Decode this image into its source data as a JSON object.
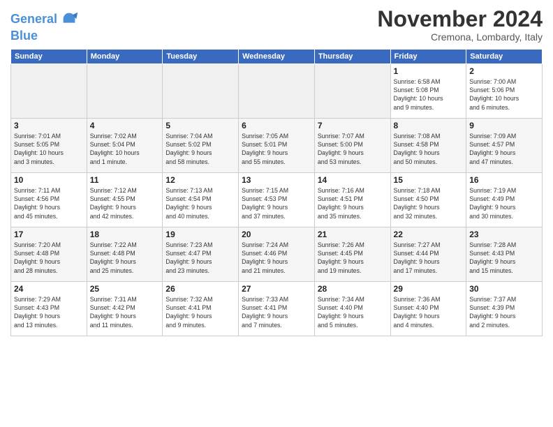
{
  "header": {
    "logo_line1": "General",
    "logo_line2": "Blue",
    "month": "November 2024",
    "location": "Cremona, Lombardy, Italy"
  },
  "weekdays": [
    "Sunday",
    "Monday",
    "Tuesday",
    "Wednesday",
    "Thursday",
    "Friday",
    "Saturday"
  ],
  "weeks": [
    {
      "days": [
        {
          "num": "",
          "info": "",
          "empty": true
        },
        {
          "num": "",
          "info": "",
          "empty": true
        },
        {
          "num": "",
          "info": "",
          "empty": true
        },
        {
          "num": "",
          "info": "",
          "empty": true
        },
        {
          "num": "",
          "info": "",
          "empty": true
        },
        {
          "num": "1",
          "info": "Sunrise: 6:58 AM\nSunset: 5:08 PM\nDaylight: 10 hours\nand 9 minutes."
        },
        {
          "num": "2",
          "info": "Sunrise: 7:00 AM\nSunset: 5:06 PM\nDaylight: 10 hours\nand 6 minutes."
        }
      ]
    },
    {
      "days": [
        {
          "num": "3",
          "info": "Sunrise: 7:01 AM\nSunset: 5:05 PM\nDaylight: 10 hours\nand 3 minutes."
        },
        {
          "num": "4",
          "info": "Sunrise: 7:02 AM\nSunset: 5:04 PM\nDaylight: 10 hours\nand 1 minute."
        },
        {
          "num": "5",
          "info": "Sunrise: 7:04 AM\nSunset: 5:02 PM\nDaylight: 9 hours\nand 58 minutes."
        },
        {
          "num": "6",
          "info": "Sunrise: 7:05 AM\nSunset: 5:01 PM\nDaylight: 9 hours\nand 55 minutes."
        },
        {
          "num": "7",
          "info": "Sunrise: 7:07 AM\nSunset: 5:00 PM\nDaylight: 9 hours\nand 53 minutes."
        },
        {
          "num": "8",
          "info": "Sunrise: 7:08 AM\nSunset: 4:58 PM\nDaylight: 9 hours\nand 50 minutes."
        },
        {
          "num": "9",
          "info": "Sunrise: 7:09 AM\nSunset: 4:57 PM\nDaylight: 9 hours\nand 47 minutes."
        }
      ]
    },
    {
      "days": [
        {
          "num": "10",
          "info": "Sunrise: 7:11 AM\nSunset: 4:56 PM\nDaylight: 9 hours\nand 45 minutes."
        },
        {
          "num": "11",
          "info": "Sunrise: 7:12 AM\nSunset: 4:55 PM\nDaylight: 9 hours\nand 42 minutes."
        },
        {
          "num": "12",
          "info": "Sunrise: 7:13 AM\nSunset: 4:54 PM\nDaylight: 9 hours\nand 40 minutes."
        },
        {
          "num": "13",
          "info": "Sunrise: 7:15 AM\nSunset: 4:53 PM\nDaylight: 9 hours\nand 37 minutes."
        },
        {
          "num": "14",
          "info": "Sunrise: 7:16 AM\nSunset: 4:51 PM\nDaylight: 9 hours\nand 35 minutes."
        },
        {
          "num": "15",
          "info": "Sunrise: 7:18 AM\nSunset: 4:50 PM\nDaylight: 9 hours\nand 32 minutes."
        },
        {
          "num": "16",
          "info": "Sunrise: 7:19 AM\nSunset: 4:49 PM\nDaylight: 9 hours\nand 30 minutes."
        }
      ]
    },
    {
      "days": [
        {
          "num": "17",
          "info": "Sunrise: 7:20 AM\nSunset: 4:48 PM\nDaylight: 9 hours\nand 28 minutes."
        },
        {
          "num": "18",
          "info": "Sunrise: 7:22 AM\nSunset: 4:48 PM\nDaylight: 9 hours\nand 25 minutes."
        },
        {
          "num": "19",
          "info": "Sunrise: 7:23 AM\nSunset: 4:47 PM\nDaylight: 9 hours\nand 23 minutes."
        },
        {
          "num": "20",
          "info": "Sunrise: 7:24 AM\nSunset: 4:46 PM\nDaylight: 9 hours\nand 21 minutes."
        },
        {
          "num": "21",
          "info": "Sunrise: 7:26 AM\nSunset: 4:45 PM\nDaylight: 9 hours\nand 19 minutes."
        },
        {
          "num": "22",
          "info": "Sunrise: 7:27 AM\nSunset: 4:44 PM\nDaylight: 9 hours\nand 17 minutes."
        },
        {
          "num": "23",
          "info": "Sunrise: 7:28 AM\nSunset: 4:43 PM\nDaylight: 9 hours\nand 15 minutes."
        }
      ]
    },
    {
      "days": [
        {
          "num": "24",
          "info": "Sunrise: 7:29 AM\nSunset: 4:43 PM\nDaylight: 9 hours\nand 13 minutes."
        },
        {
          "num": "25",
          "info": "Sunrise: 7:31 AM\nSunset: 4:42 PM\nDaylight: 9 hours\nand 11 minutes."
        },
        {
          "num": "26",
          "info": "Sunrise: 7:32 AM\nSunset: 4:41 PM\nDaylight: 9 hours\nand 9 minutes."
        },
        {
          "num": "27",
          "info": "Sunrise: 7:33 AM\nSunset: 4:41 PM\nDaylight: 9 hours\nand 7 minutes."
        },
        {
          "num": "28",
          "info": "Sunrise: 7:34 AM\nSunset: 4:40 PM\nDaylight: 9 hours\nand 5 minutes."
        },
        {
          "num": "29",
          "info": "Sunrise: 7:36 AM\nSunset: 4:40 PM\nDaylight: 9 hours\nand 4 minutes."
        },
        {
          "num": "30",
          "info": "Sunrise: 7:37 AM\nSunset: 4:39 PM\nDaylight: 9 hours\nand 2 minutes."
        }
      ]
    }
  ]
}
